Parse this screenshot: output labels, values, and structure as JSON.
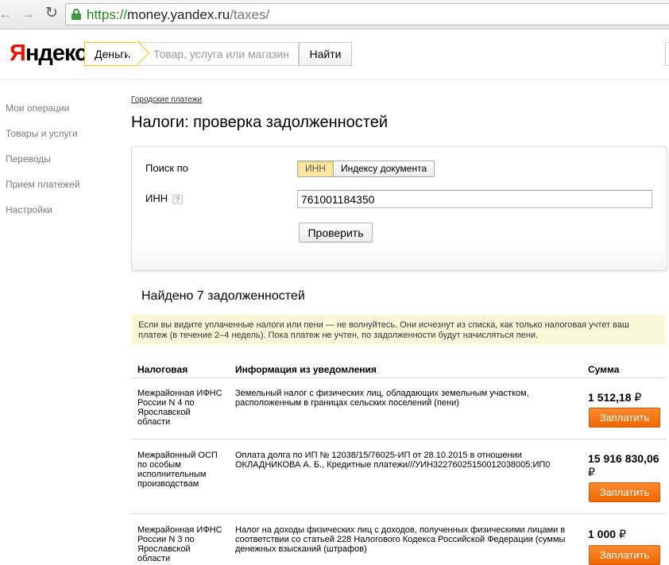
{
  "browser": {
    "url_scheme": "https://",
    "url_host": "money.yandex.ru",
    "url_path": "/taxes/"
  },
  "header": {
    "logo_first": "Я",
    "logo_rest": "ндекс",
    "search_tag": "Деньги",
    "search_placeholder": "Товар, услуга или магазин",
    "find_label": "Найти"
  },
  "sidebar": {
    "items": [
      {
        "label": "Мои операции"
      },
      {
        "label": "Товары и услуги"
      },
      {
        "label": "Переводы"
      },
      {
        "label": "Прием платежей"
      },
      {
        "label": "Настройки"
      }
    ]
  },
  "main": {
    "breadcrumb": "Городские платежи",
    "title": "Налоги: проверка задолженностей",
    "search_by_label": "Поиск по",
    "options": [
      {
        "label": "ИНН",
        "active": true
      },
      {
        "label": "Индексу документа",
        "active": false
      }
    ],
    "inn_label": "ИНН",
    "help_glyph": "?",
    "inn_value": "761001184350",
    "check_label": "Проверить",
    "found_text": "Найдено 7 задолженностей",
    "notice": "Если вы видите уплаченные налоги или пени — не волнуйтесь. Они исчезнут из списка, как только налоговая учтет ваш платеж (в течение 2–4 недель). Пока платеж не учтен, по задолженности будут начисляться пени."
  },
  "table": {
    "headers": {
      "org": "Налоговая",
      "info": "Информация из уведомления",
      "amount": "Сумма"
    },
    "pay_label": "Заплатить",
    "currency": "₽",
    "rows": [
      {
        "org": "Межрайонная ИФНС России N 4 по Ярославской области",
        "info": "Земельный налог с физических лиц, обладающих земельным участком, расположенным в границах сельских поселений (пени)",
        "amount": "1 512,18"
      },
      {
        "org": "Межрайонный ОСП по особым исполнительным производствам",
        "info": "Оплата долга по ИП № 12038/15/76025-ИП от 28.10.2015 в отношении ОКЛАДНИКОВА А. Б., Кредитные платежи///УИН32276025150012038005;ИП0",
        "amount": "15 916 830,06"
      },
      {
        "org": "Межрайонная ИФНС России N 3 по Ярославской области",
        "info": "Налог на доходы физических лиц с доходов, полученных физическими лицами в соответствии со статьей 228 Налогового Кодекса Российской Федерации (суммы денежных взысканий (штрафов)",
        "amount": "1 000"
      }
    ]
  }
}
